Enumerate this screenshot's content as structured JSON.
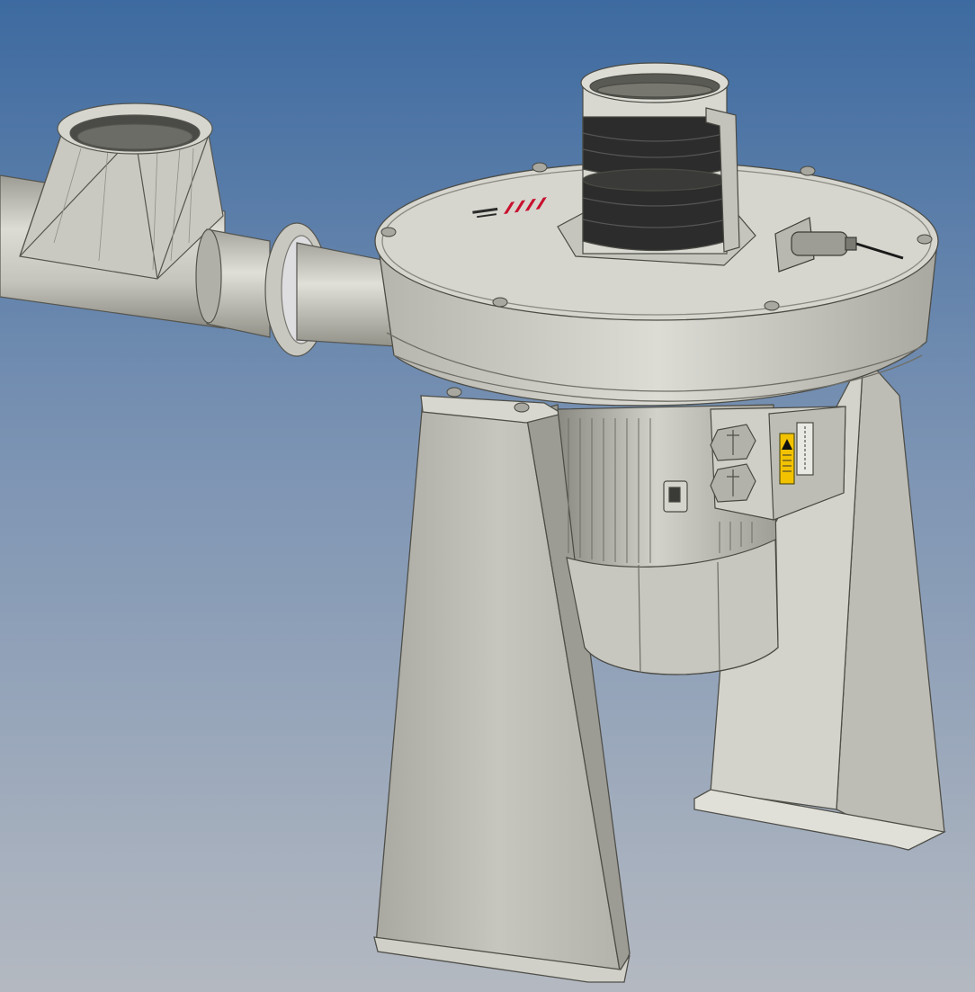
{
  "scene": {
    "colors": {
      "background_top": "#3d6aa0",
      "background_bottom": "#b4b9c1",
      "metal_light": "#d9d9d2",
      "metal_mid": "#b8b8b0",
      "metal_dark": "#8e8e86",
      "rubber": "#2c2c2c",
      "brand_red": "#c8102e",
      "warning_yellow": "#f2c200"
    },
    "icons": {
      "logo": "brand-logo-icon",
      "warning": "electrical-warning-icon"
    }
  }
}
